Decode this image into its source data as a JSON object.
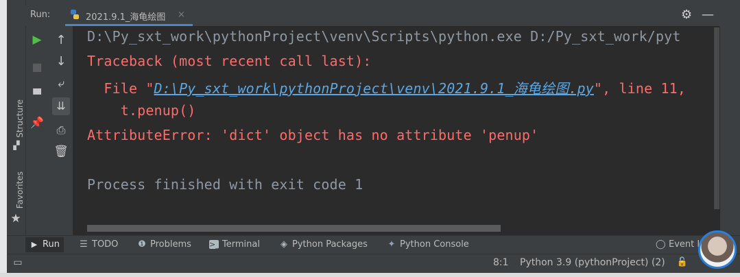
{
  "run_header": {
    "label": "Run:",
    "tab_title": "2021.9.1_海龟绘图",
    "tab_close": "×"
  },
  "side_tabs": {
    "structure": "Structure",
    "favorites": "Favorites"
  },
  "console": {
    "line1": "D:\\Py_sxt_work\\pythonProject\\venv\\Scripts\\python.exe D:/Py_sxt_work/pyt",
    "line2": "Traceback (most recent call last):",
    "line3_prefix": "  File \"",
    "line3_link": "D:\\Py_sxt_work\\pythonProject\\venv\\2021.9.1_海龟绘图.py",
    "line3_suffix": "\", line 11,",
    "line4": "    t.penup()",
    "line5": "AttributeError: 'dict' object has no attribute 'penup'",
    "line7": "Process finished with exit code 1"
  },
  "bottom_tabs": {
    "run": "Run",
    "todo": "TODO",
    "problems": "Problems",
    "terminal": "Terminal",
    "python_packages": "Python Packages",
    "python_console": "Python Console",
    "event_log": "Event L"
  },
  "status_bar": {
    "position": "8:1",
    "interpreter": "Python 3.9 (pythonProject) (2)"
  },
  "colors": {
    "console_bg": "#2b2b2b",
    "error_red": "#ff6b68",
    "link_blue": "#5aa7e4",
    "run_green": "#4fbf45"
  }
}
